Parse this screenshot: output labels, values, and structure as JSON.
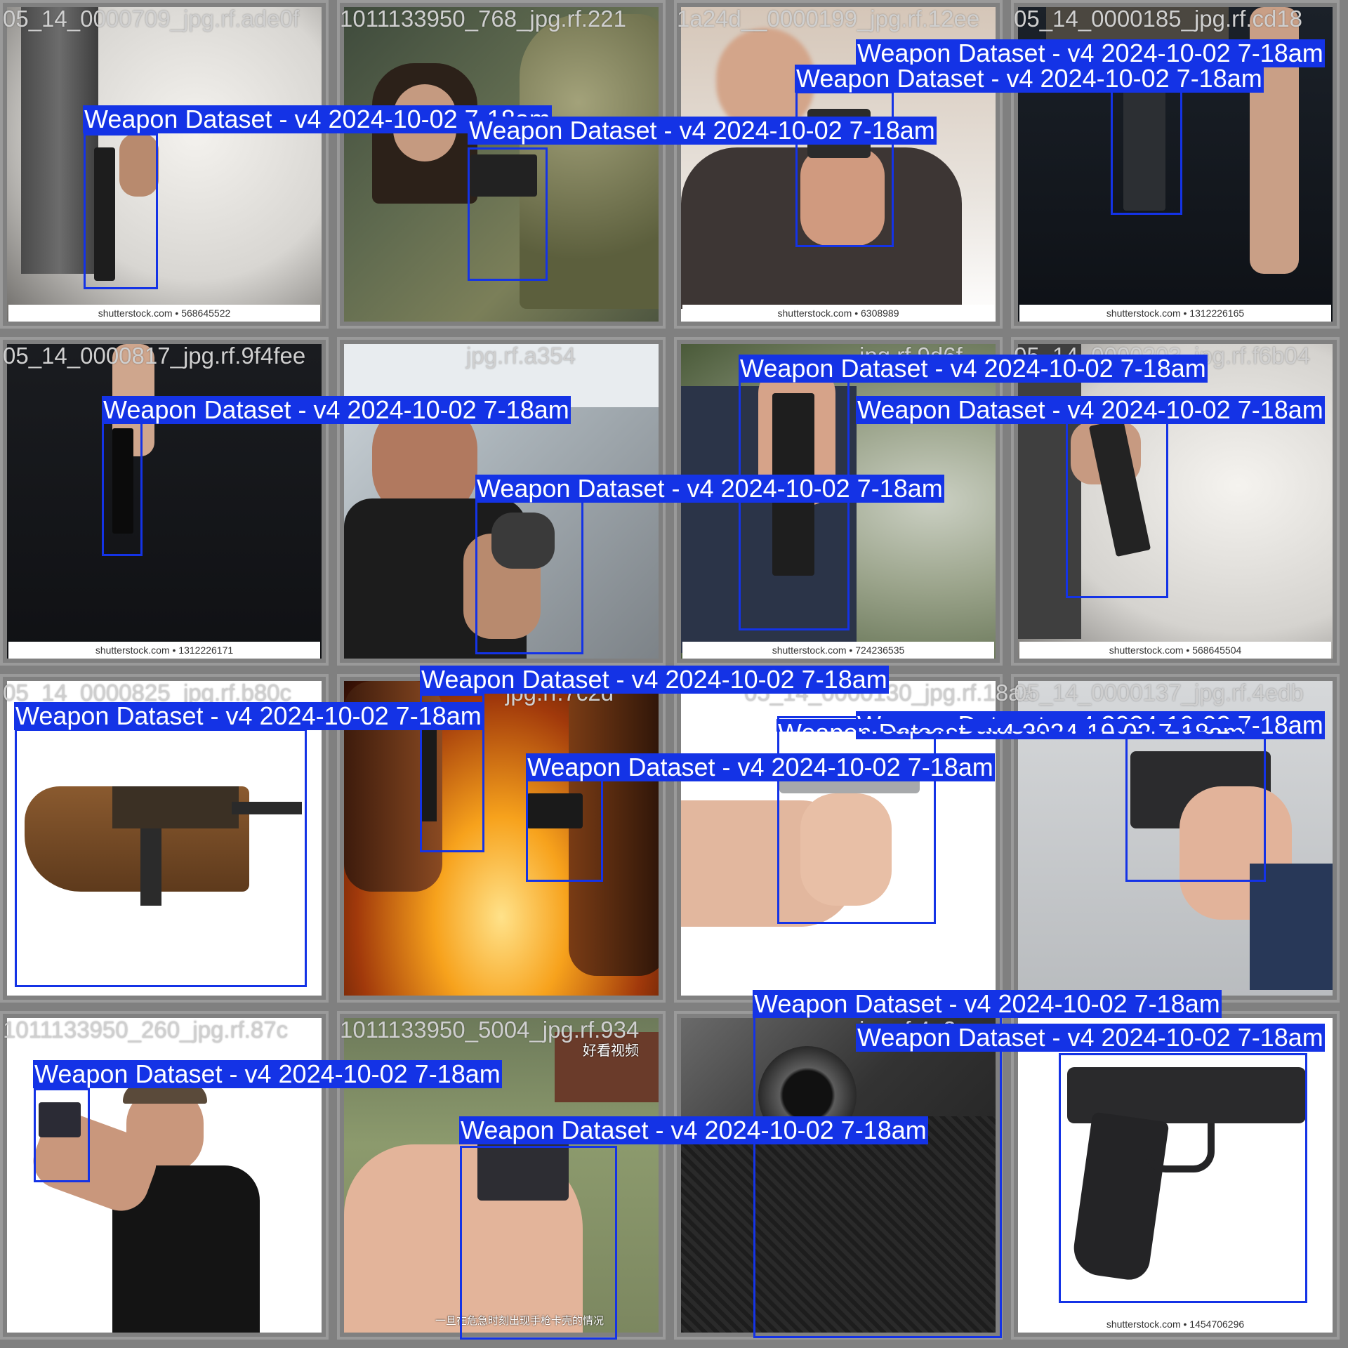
{
  "colors": {
    "box": "#1433e6",
    "label_text": "#ffffff",
    "filename_text": "#cfcfcf",
    "grid_background": "#808080"
  },
  "label": "Weapon Dataset - v4 2024-10-02 7-18am",
  "tiles": [
    {
      "name": "05_14_0000709_jpg.rf.ade0f",
      "credit": "shutterstock.com • 568645522"
    },
    {
      "name": "1011133950_768_jpg.rf.221"
    },
    {
      "name": "1a24d__0000199_jpg.rf.12ee"
    },
    {
      "name": "05_14_0000185_jpg.rf.cd18",
      "credit": "shutterstock.com • 1312226165"
    },
    {
      "name": "05_14_0000817_jpg.rf.9f4fee"
    },
    {
      "name": "jpg.rf.a354"
    },
    {
      "name": "jpg.rf.9d6f",
      "credit": "shutterstock.com • 724236535"
    },
    {
      "name": "05_14_0000203_jpg.rf.f6b04",
      "credit": "shutterstock.com • 568645504"
    },
    {
      "name": "05_14_0000825_jpg.rf.b80c"
    },
    {
      "name": "jpg.rf.7c2d"
    },
    {
      "name": "05_14_0000130_jpg.rf.18aa"
    },
    {
      "name": "05_14_0000137_jpg.rf.4edb"
    },
    {
      "name": "1011133950_260_jpg.rf.87c"
    },
    {
      "name": "1011133950_5004_jpg.rf.934"
    },
    {
      "name": "jpg.rf.4e2e"
    },
    {
      "name": "",
      "credit": "shutterstock.com • 1454706296"
    }
  ],
  "credits": {
    "t2": "shutterstock.com • 6308989",
    "t5": "shutterstock.com • 1312226171"
  },
  "overlay": {
    "watermark": "好看视频",
    "subtitle": "一旦在危急时刻出现手枪卡壳的情况"
  }
}
